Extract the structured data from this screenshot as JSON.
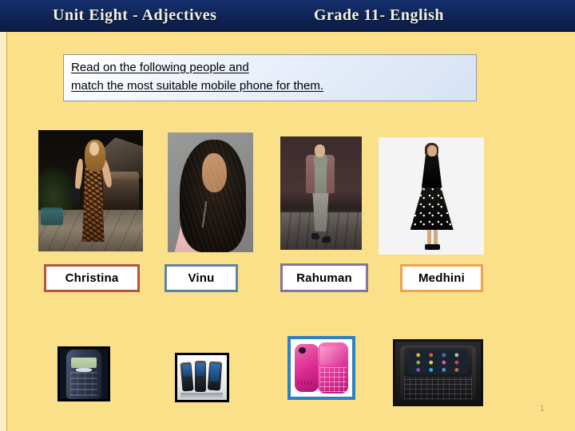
{
  "header": {
    "unit_title": "Unit  Eight  - Adjectives",
    "grade_title": "Grade 11- English",
    "background_color": "#12275e",
    "text_color": "#f3f1e4"
  },
  "instruction": {
    "line1": "Read on the following people and",
    "line2": " match the most suitable mobile phone for them.",
    "background_color": "#e6eefa",
    "border_color": "#8f9aa6"
  },
  "slide": {
    "background_color": "#fbe08a",
    "page_number": "1"
  },
  "people": [
    {
      "name": "Christina",
      "label_border_color": "#b4553f",
      "photo_alt": "woman in leopard print maxi dress at night"
    },
    {
      "name": "Vinu",
      "label_border_color": "#5b86a3",
      "photo_alt": "woman with long curly dark hair in pink top"
    },
    {
      "name": "Rahuman",
      "label_border_color": "#86739e",
      "photo_alt": "male runway model in mauve jacket and grey scarf"
    },
    {
      "name": "Medhini",
      "label_border_color": "#eda34e",
      "photo_alt": "woman in black top and polka dot skirt"
    }
  ],
  "phones": [
    {
      "alt": "dark blue Nokia candybar phone with green LCD screen",
      "border_color": "#000000"
    },
    {
      "alt": "three dark slim phones with blue screens",
      "border_color": "#000000"
    },
    {
      "alt": "pink QWERTY keypad phone front and back",
      "border_color": "#2f7fc1"
    },
    {
      "alt": "black Samsung slider smartphone with app icon grid",
      "border_color": "#101010"
    }
  ]
}
